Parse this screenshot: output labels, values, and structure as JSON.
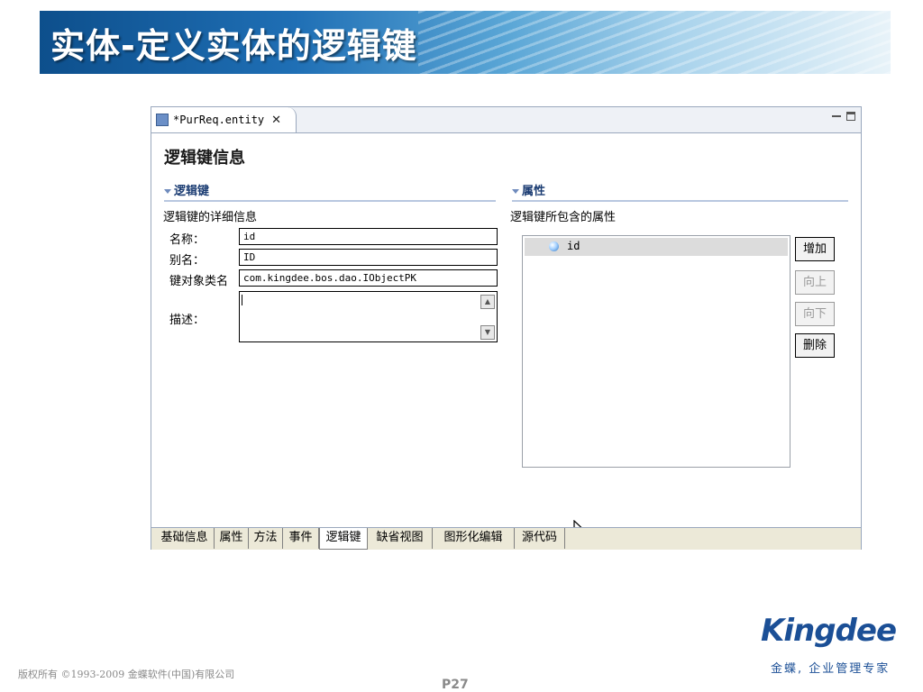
{
  "slide": {
    "title": "实体-定义实体的逻辑键",
    "page_number": "P27",
    "copyright": "版权所有 ©1993-2009 金蝶软件(中国)有限公司",
    "brand": "Kingdee",
    "slogan": "金蝶, 企业管理专家",
    "colors": {
      "brand": "#1b4f96",
      "banner_dark": "#0d4f8c"
    }
  },
  "editor": {
    "tab_title": "*PurReq.entity",
    "tab_icon": "entity-file-icon",
    "section_heading": "逻辑键信息",
    "logical_key": {
      "header": "逻辑键",
      "description": "逻辑键的详细信息",
      "fields": {
        "name_label": "名称：",
        "name_value": "id",
        "alias_label": "别名：",
        "alias_value": "ID",
        "key_class_label": "键对象类名",
        "key_class_value": "com.kingdee.bos.dao.IObjectPK",
        "description_label": "描述："
      }
    },
    "attributes": {
      "header": "属性",
      "description": "逻辑键所包含的属性",
      "items": [
        "id"
      ],
      "buttons": {
        "add": "增加",
        "up": "向上",
        "down": "向下",
        "delete": "删除"
      }
    },
    "bottom_tabs": [
      "基础信息",
      "属性",
      "方法",
      "事件",
      "逻辑键",
      "缺省视图",
      "图形化编辑",
      "源代码"
    ],
    "active_tab": "逻辑键"
  }
}
